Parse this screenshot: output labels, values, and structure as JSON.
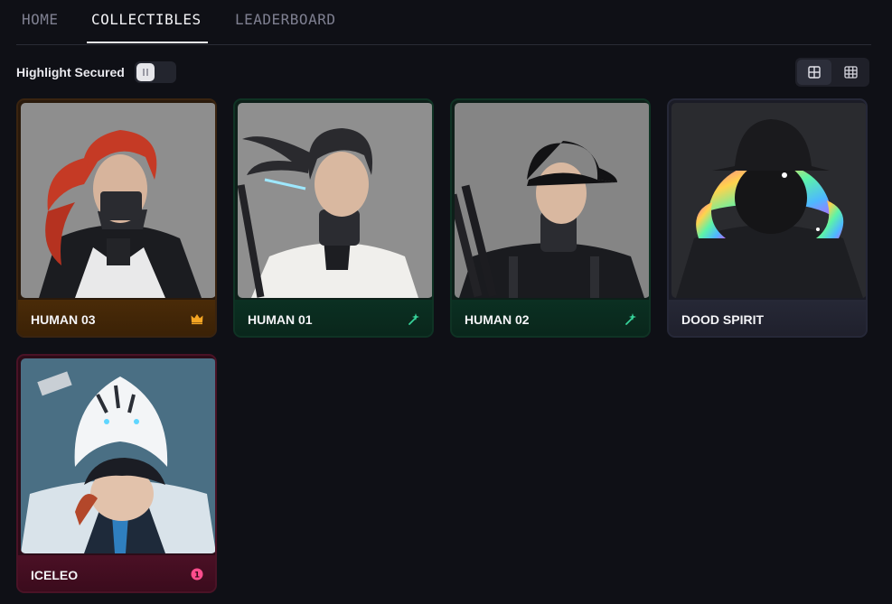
{
  "tabs": {
    "home": "HOME",
    "collectibles": "COLLECTIBLES",
    "leaderboard": "LEADERBOARD",
    "active": "COLLECTIBLES"
  },
  "toolbar": {
    "toggle_label": "Highlight Secured",
    "toggle_on": false,
    "view_mode": "large-grid"
  },
  "cards": [
    {
      "name": "HUMAN 03",
      "tier_color": "#f5a623",
      "badge_icon": "crown-icon",
      "portrait": "red-haired masked character"
    },
    {
      "name": "HUMAN 01",
      "tier_color": "#37d39a",
      "badge_icon": "sparkle-pin-icon",
      "portrait": "ponytail swordsman"
    },
    {
      "name": "HUMAN 02",
      "tier_color": "#37d39a",
      "badge_icon": "sparkle-pin-icon",
      "portrait": "cap wearing character"
    },
    {
      "name": "DOOD SPIRIT",
      "tier_color": "#8d8fa6",
      "badge_icon": "",
      "portrait": "hooded rainbow-haired spirit"
    },
    {
      "name": "ICELEO",
      "tier_color": "#ff4d8d",
      "badge_icon": "alert-dot-icon",
      "badge_text": "1",
      "portrait": "white tiger hooded character"
    }
  ]
}
